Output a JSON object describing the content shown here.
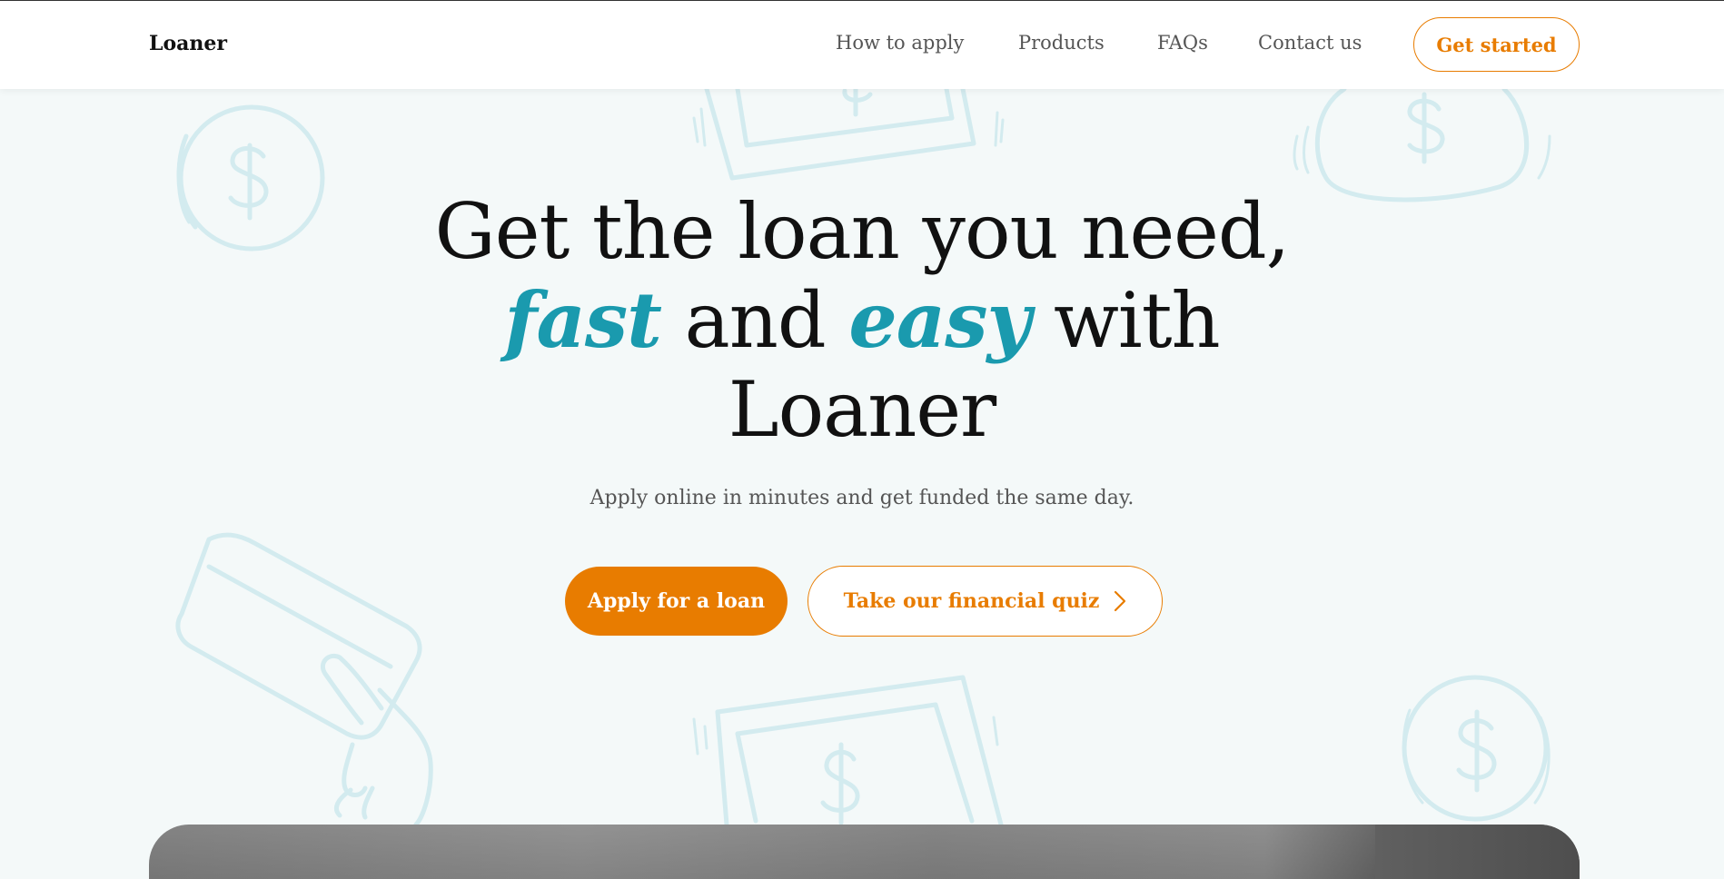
{
  "header": {
    "logo": "Loaner",
    "nav": [
      {
        "label": "How to apply"
      },
      {
        "label": "Products"
      },
      {
        "label": "FAQs"
      },
      {
        "label": "Contact us"
      }
    ],
    "cta_label": "Get started"
  },
  "hero": {
    "title_line1": "Get the loan you need,",
    "title_accent1": "fast",
    "title_mid": " and ",
    "title_accent2": "easy",
    "title_end": " with",
    "title_line3": "Loaner",
    "subtitle": "Apply online in minutes and get funded the same day.",
    "primary_button": "Apply for a loan",
    "secondary_button": "Take our financial quiz"
  },
  "colors": {
    "accent_orange": "#e87c00",
    "accent_teal": "#1a9aae",
    "background": "#f4f9f9",
    "doodle": "#d3ebef"
  },
  "icons": {
    "quiz_button": "chevron-right-icon",
    "doodles": [
      "coin-icon",
      "banknote-icon",
      "money-bag-icon",
      "credit-card-hand-icon",
      "banknote-icon",
      "coin-icon"
    ]
  }
}
